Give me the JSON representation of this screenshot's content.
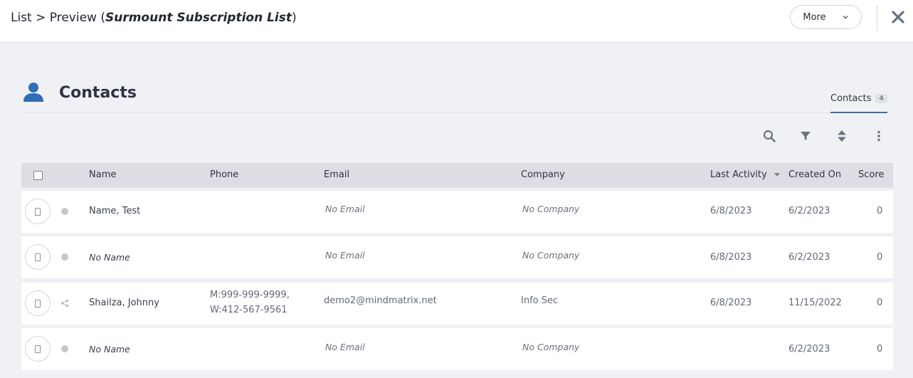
{
  "header": {
    "breadcrumb_prefix": "List > Preview (",
    "list_name": "Surmount Subscription List",
    "breadcrumb_suffix": ")",
    "more_label": "More"
  },
  "section": {
    "title": "Contacts",
    "tab_label": "Contacts",
    "tab_count": "4"
  },
  "table": {
    "columns": [
      "Name",
      "Phone",
      "Email",
      "Company",
      "Last Activity",
      "Created On",
      "Score"
    ],
    "rows": [
      {
        "name": "Name, Test",
        "phone1": "",
        "phone2": "",
        "email": "No Email",
        "company": "No Company",
        "last_activity": "6/8/2023",
        "created_on": "6/2/2023",
        "score": "0",
        "status_icon": "status-dot-icon"
      },
      {
        "name": "No Name",
        "phone1": "",
        "phone2": "",
        "email": "No Email",
        "company": "No Company",
        "last_activity": "6/8/2023",
        "created_on": "6/2/2023",
        "score": "0",
        "status_icon": "status-dot-icon"
      },
      {
        "name": "Shailza, Johnny",
        "phone1": "M:999-999-9999,",
        "phone2": "W:412-567-9561",
        "email": "demo2@mindmatrix.net",
        "company": "Info Sec",
        "last_activity": "6/8/2023",
        "created_on": "11/15/2022",
        "score": "0",
        "status_icon": "share-icon"
      },
      {
        "name": "No Name",
        "phone1": "",
        "phone2": "",
        "email": "No Email",
        "company": "No Company",
        "last_activity": "",
        "created_on": "6/2/2023",
        "score": "0",
        "status_icon": "status-dot-icon"
      }
    ]
  },
  "colors": {
    "accent": "#3b6ea8",
    "icon_blue": "#2f6eb5",
    "toolbar_icon": "#6b7280"
  }
}
